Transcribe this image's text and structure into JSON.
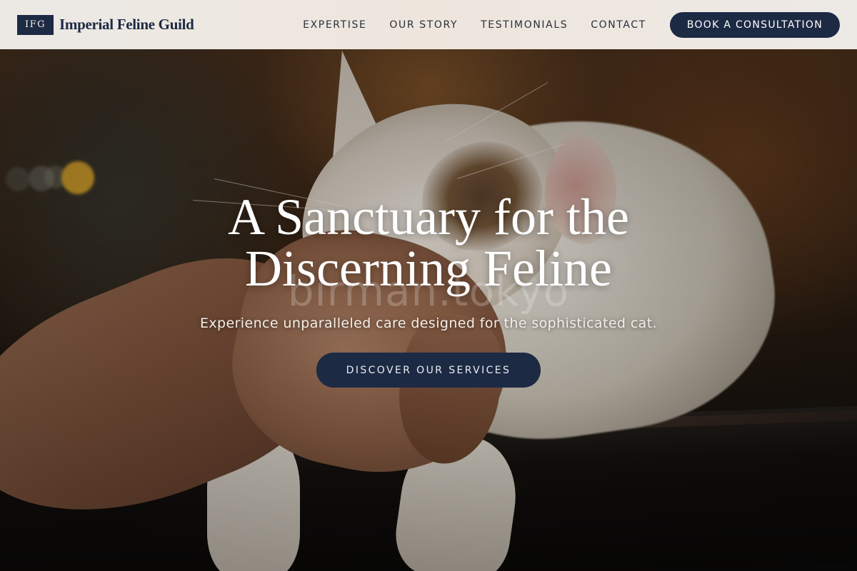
{
  "brand": {
    "badge": "IFG",
    "name": "Imperial Feline Guild"
  },
  "nav": {
    "links": [
      "EXPERTISE",
      "OUR STORY",
      "TESTIMONIALS",
      "CONTACT"
    ],
    "cta_label": "BOOK A CONSULTATION"
  },
  "hero": {
    "title_line1": "A Sanctuary for the",
    "title_line2": "Discerning Feline",
    "subtitle": "Experience unparalleled care designed for the sophisticated cat.",
    "cta_label": "DISCOVER OUR SERVICES",
    "watermark": "birman.tokyo"
  },
  "colors": {
    "primary": "#1d2a44",
    "nav_bg": "#ece9e5",
    "hero_text": "#ffffff"
  }
}
